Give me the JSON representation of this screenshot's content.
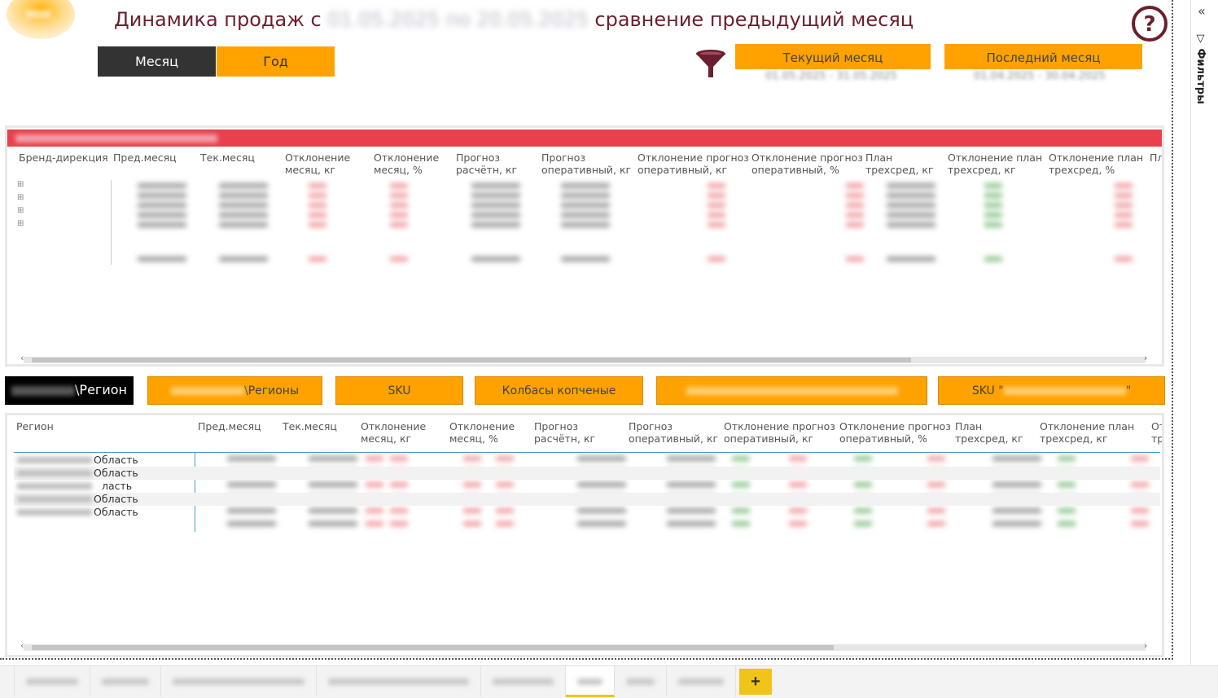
{
  "header": {
    "title_prefix": "Динамика продаж с",
    "title_redacted": "01.05.2025 по 20.05.2025",
    "title_suffix": "сравнение предыдущий месяц"
  },
  "period_toggle": {
    "month_label": "Месяц",
    "year_label": "Год"
  },
  "period_buttons": {
    "current_label": "Текущий месяц",
    "current_range": "01.05.2025 - 31.05.2025",
    "last_label": "Последний месяц",
    "last_range": "01.04.2025 - 30.04.2025"
  },
  "table1": {
    "columns": [
      "Бренд-дирекция",
      "Пред.месяц",
      "Тек.месяц",
      "Отклонение\nмесяц, кг",
      "Отклонение\nмесяц, %",
      "Прогноз\nрасчётн, кг",
      "Прогноз\nоперативный, кг",
      "Отклонение прогноз\nоперативный, кг",
      "Отклонение прогноз\nоперативный, %",
      "План\nтрехсред, кг",
      "Отклонение план\nтрехсред, кг",
      "Отклонение план\nтрехсред, %",
      "Пл"
    ]
  },
  "nav_buttons": {
    "region_label": "\\Регион",
    "regions_label": "\\Регионы",
    "sku_label": "SKU",
    "sausage_label": "Колбасы копченые",
    "sku_quote_label": "SKU \"",
    "sku_quote_end": "\""
  },
  "table2": {
    "columns": [
      "Регион",
      "Пред.месяц",
      "Тек.месяц",
      "Отклонение\nмесяц, кг",
      "Отклонение\nмесяц, %",
      "Прогноз\nрасчётн, кг",
      "Прогноз\nоперативный, кг",
      "Отклонение прогноз\nоперативный, кг",
      "Отклонение прогноз\nоперативный, %",
      "План\nтрехсред, кг",
      "Отклонение план\nтрехсред, кг",
      "Откл\nтрех"
    ],
    "region_suffixes": [
      "Область",
      "Область",
      "ласть",
      "Область",
      "Область"
    ]
  },
  "filters_pane": {
    "label": "Фильтры",
    "collapse_icon": "double-chevron-left-icon"
  },
  "tabs": {
    "add_label": "+"
  },
  "colors": {
    "orange": "#ffa200",
    "red_header": "#e8404c",
    "title": "#6b1f2e",
    "active_tab": "#f0c419"
  }
}
